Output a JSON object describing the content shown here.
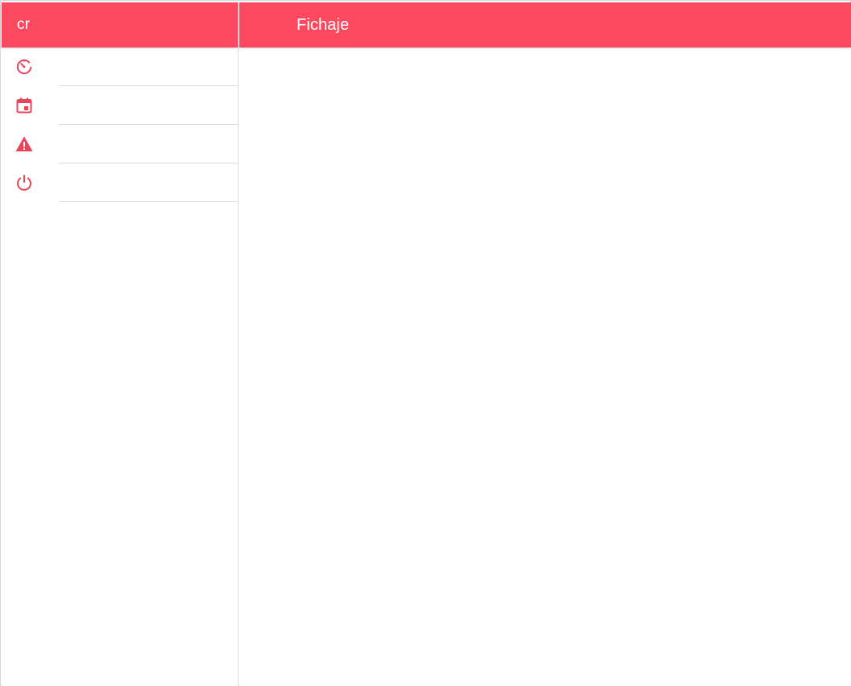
{
  "colors": {
    "primary": "#fb4a5f",
    "icon": "#e8455a",
    "divider": "#dadada",
    "background": "#ffffff"
  },
  "side_menu": {
    "title": "cr",
    "items": [
      {
        "icon": "timer-icon",
        "label": ""
      },
      {
        "icon": "calendar-icon",
        "label": ""
      },
      {
        "icon": "warning-icon",
        "label": ""
      },
      {
        "icon": "power-icon",
        "label": ""
      }
    ]
  },
  "main": {
    "title": "Fichaje"
  }
}
